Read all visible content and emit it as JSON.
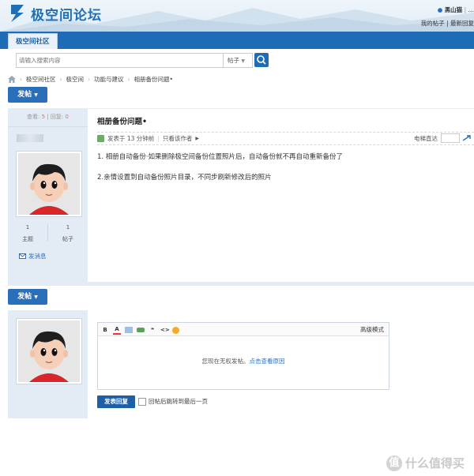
{
  "site": {
    "logo_text": "极空间论坛"
  },
  "userbar": {
    "username": "黑山猫",
    "links_row2": [
      "我的帖子",
      "最新回复"
    ]
  },
  "nav": {
    "tab_label": "极空间社区"
  },
  "search": {
    "placeholder": "请输入搜索内容",
    "type_label": "帖子"
  },
  "breadcrumb": [
    "极空间社区",
    "极空间",
    "功能与建议",
    "相册备份问题•"
  ],
  "post_button": {
    "label": "发帖"
  },
  "thread": {
    "stats": {
      "views_label": "查看:",
      "views": "5",
      "replies_label": "回复:",
      "replies": "0"
    },
    "author_stats": [
      {
        "value": "1",
        "label": "主题"
      },
      {
        "value": "1",
        "label": "帖子"
      }
    ],
    "send_message": "发消息",
    "title": "相册备份问题•",
    "meta": {
      "posted": "发表于 13 分钟前",
      "only_author": "只看该作者",
      "floor_jump": "电梯直达"
    },
    "content": [
      "1. 相册自动备份·如果删除极空间备份位置照片后，自动备份就不再自动重新备份了",
      "2.亲情设置到自动备份照片目录，不同步刷新修改后的照片"
    ]
  },
  "reply": {
    "advanced_mode": "高级模式",
    "no_permission_text": "您现在无权发帖。",
    "no_permission_link": "点击查看原因",
    "submit_label": "发表回复",
    "jump_label": "回帖后跳转到最后一页"
  },
  "watermark": {
    "icon_char": "值",
    "text": "什么值得买"
  },
  "colors": {
    "accent": "#1f6cb6",
    "stats_number": "#f26c4f",
    "panel_bg": "#e3ecf5"
  }
}
